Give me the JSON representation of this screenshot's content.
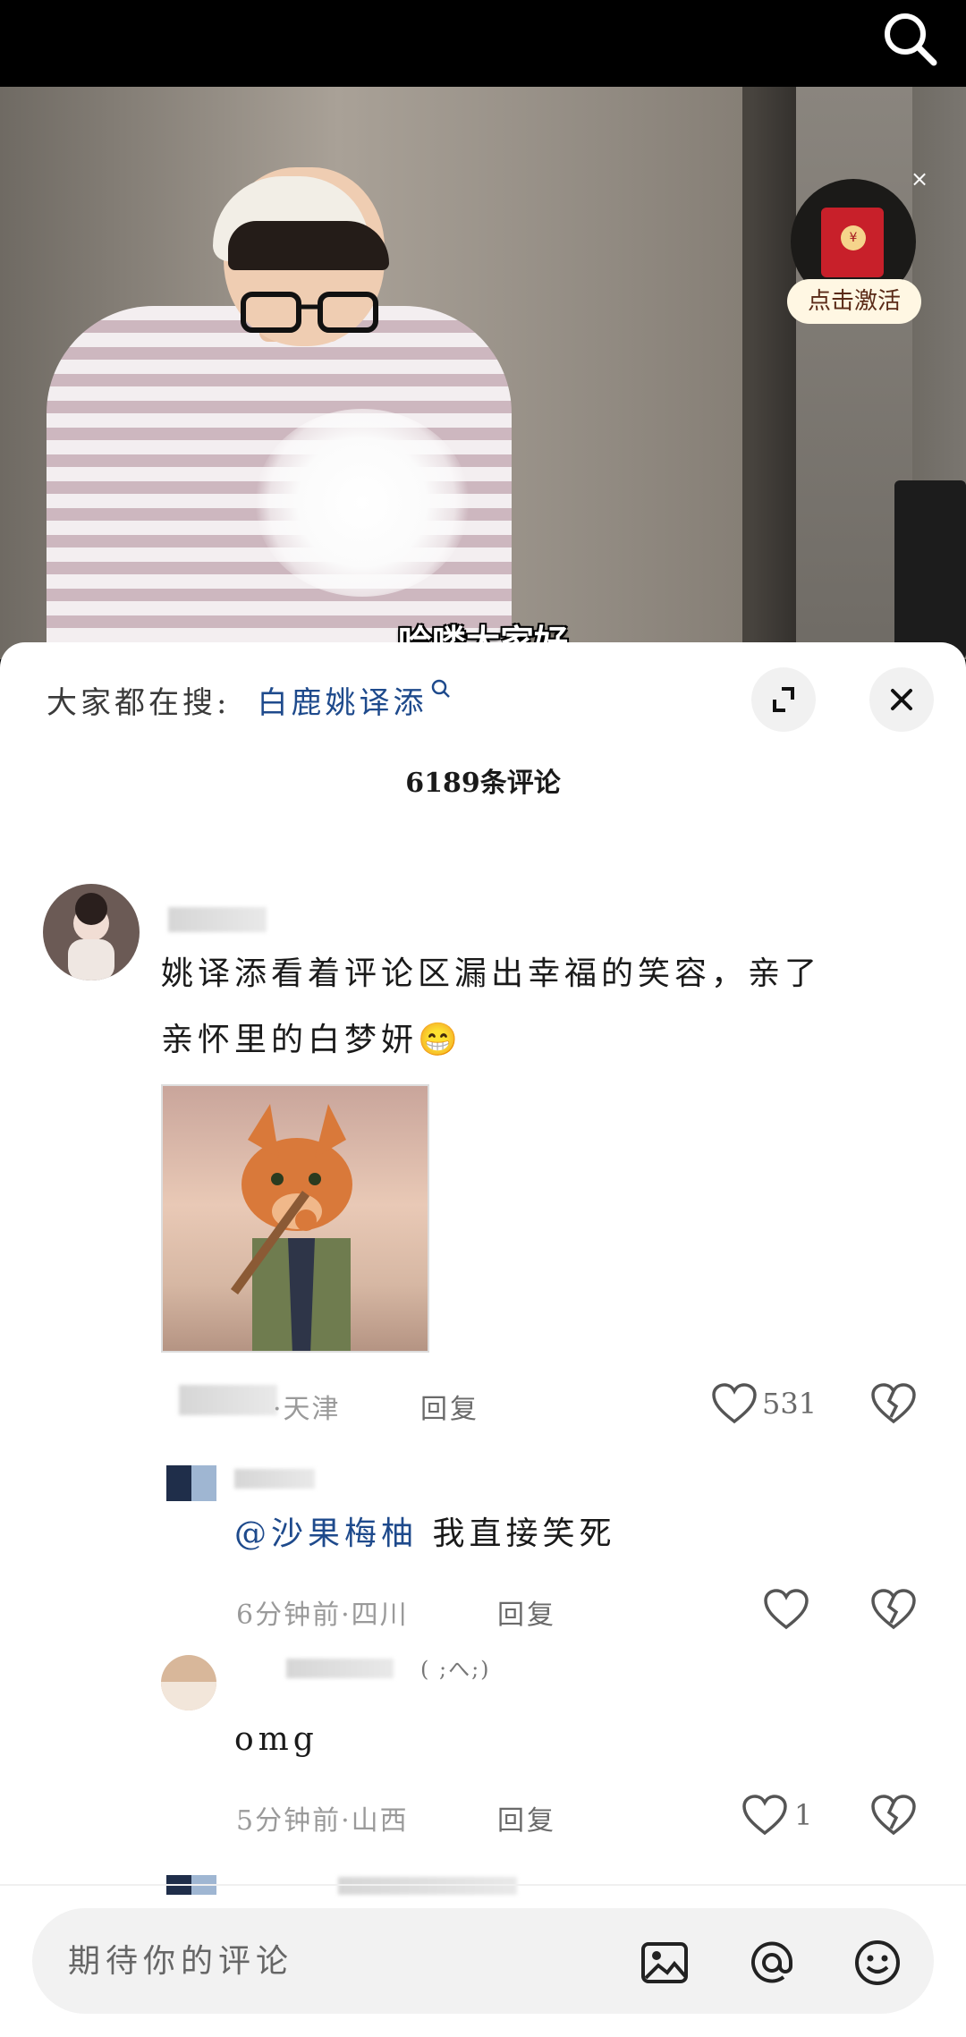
{
  "video": {
    "subtitle": "哈喽大家好",
    "red_packet_label": "点击激活",
    "red_packet_coin": "¥",
    "close_symbol": "×"
  },
  "panel": {
    "hot_search_prefix": "大家都在搜:",
    "hot_search_term": "白鹿姚译添",
    "comment_count": "6189条评论"
  },
  "comments": [
    {
      "text_line1": "姚译添看着评论区漏出幸福的笑容，亲了",
      "text_line2": "亲怀里的白梦妍",
      "emoji": "😁",
      "meta": "·天津",
      "reply": "回复",
      "likes": "531"
    },
    {
      "mention": "@沙果梅柚",
      "text": "我直接笑死",
      "meta": "6分钟前·四川",
      "reply": "回复",
      "likes": ""
    },
    {
      "name_suffix": "( ;へ;)",
      "text": "omg",
      "meta": "5分钟前·山西",
      "reply": "回复",
      "likes": "1"
    }
  ],
  "input": {
    "placeholder": "期待你的评论"
  },
  "icons": {
    "search": "search-icon",
    "expand": "expand-icon",
    "close": "close-icon",
    "like": "heart-icon",
    "dislike": "broken-heart-icon",
    "image": "image-icon",
    "mention": "at-icon",
    "emoji": "emoji-icon"
  }
}
